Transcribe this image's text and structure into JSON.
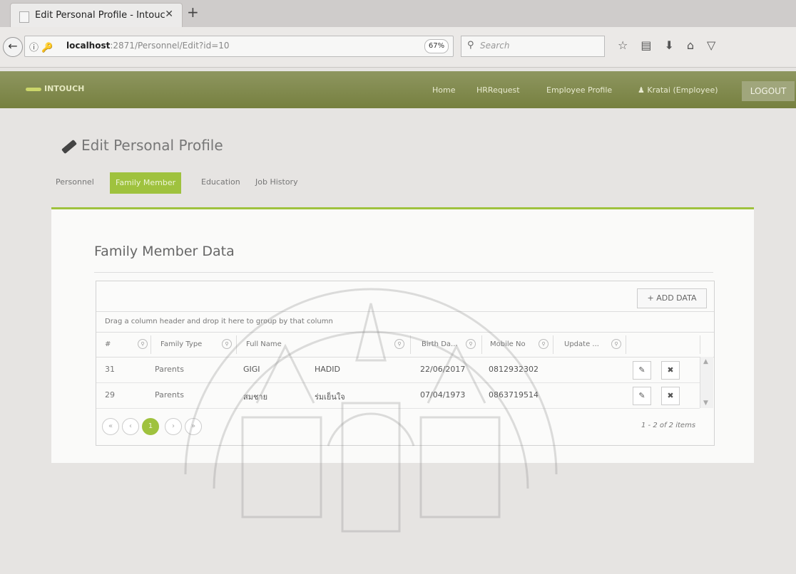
{
  "browser": {
    "tab_title": "Edit Personal Profile - Intouc",
    "url_host": "localhost",
    "url_rest": ":2871/Personnel/Edit?id=10",
    "zoom": "67%",
    "search_placeholder": "Search"
  },
  "app": {
    "brand": "INTOUCH",
    "nav": [
      "Home",
      "HRRequest",
      "Employee Profile",
      "Kratai (Employee)"
    ],
    "logout": "LOGOUT"
  },
  "page": {
    "title": "Edit Personal Profile",
    "tabs": [
      "Personnel",
      "Family Member",
      "Education",
      "Job History"
    ],
    "active_tab": "Family Member"
  },
  "section": {
    "title": "Family Member Data",
    "add_button": "+ ADD DATA",
    "group_hint": "Drag a column header and drop it here to group by that column"
  },
  "grid": {
    "columns": [
      "#",
      "Family Type",
      "Full Name",
      "Birth Da...",
      "Mobile No",
      "Update ..."
    ],
    "rows": [
      {
        "id": "31",
        "family_type": "Parents",
        "first_name": "GIGI",
        "last_name": "HADID",
        "birth_date": "22/06/2017",
        "mobile": "0812932302"
      },
      {
        "id": "29",
        "family_type": "Parents",
        "first_name": "สมชาย",
        "last_name": "ร่มเย็นใจ",
        "birth_date": "07/04/1973",
        "mobile": "0863719514"
      }
    ],
    "current_page": "1",
    "items_summary": "1 - 2 of 2 items"
  },
  "colors": {
    "accent": "#9fc23e",
    "header": "#7d8747"
  }
}
